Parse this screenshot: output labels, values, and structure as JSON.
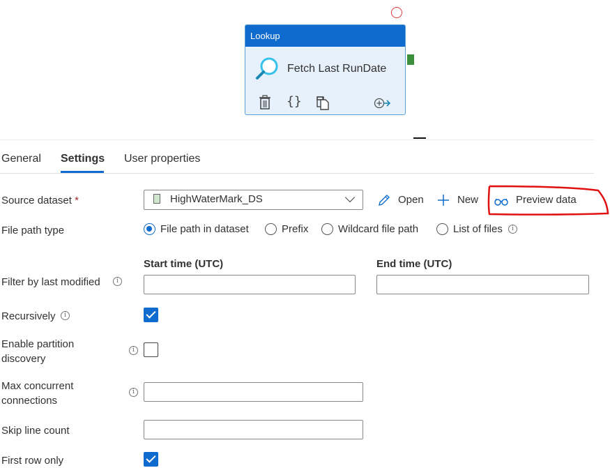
{
  "activity": {
    "type_label": "Lookup",
    "name": "Fetch Last RunDate",
    "icon": "magnifier-icon",
    "actions": [
      "delete-icon",
      "code-braces-icon",
      "copy-icon",
      "add-output-icon"
    ],
    "header_color": "#0f6cce",
    "success_connector_color": "#3c8f3c"
  },
  "tabs": [
    {
      "label": "General",
      "active": false
    },
    {
      "label": "Settings",
      "active": true
    },
    {
      "label": "User properties",
      "active": false
    }
  ],
  "settings": {
    "source_dataset": {
      "label": "Source dataset",
      "required_mark": "*",
      "value": "HighWaterMark_DS",
      "actions": {
        "open": "Open",
        "new": "New",
        "preview": "Preview data"
      }
    },
    "file_path_type": {
      "label": "File path type",
      "options": [
        {
          "label": "File path in dataset",
          "selected": true
        },
        {
          "label": "Prefix",
          "selected": false
        },
        {
          "label": "Wildcard file path",
          "selected": false
        },
        {
          "label": "List of files",
          "selected": false
        }
      ]
    },
    "filter_last_modified": {
      "label": "Filter by last modified",
      "start_label": "Start time (UTC)",
      "end_label": "End time (UTC)",
      "start_value": "",
      "end_value": ""
    },
    "recursively": {
      "label": "Recursively",
      "checked": true
    },
    "partition_discovery": {
      "label_line1": "Enable partition",
      "label_line2": "discovery",
      "checked": false
    },
    "max_connections": {
      "label_line1": "Max concurrent",
      "label_line2": "connections",
      "value": ""
    },
    "skip_line_count": {
      "label": "Skip line count",
      "value": ""
    },
    "first_row_only": {
      "label": "First row only",
      "checked": true
    }
  },
  "annotation": {
    "color": "#e01010",
    "target": "Preview data"
  },
  "info_glyph": "i",
  "accent_color": "#0f6cce"
}
